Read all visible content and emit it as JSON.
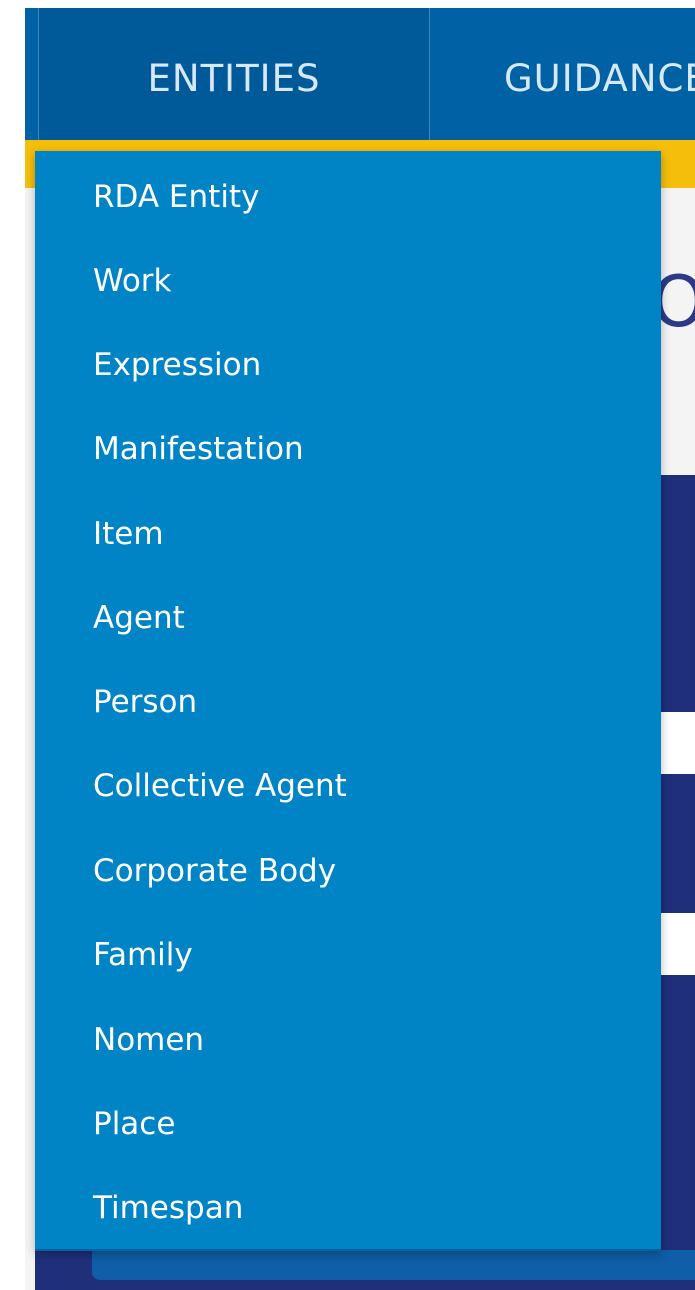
{
  "nav": {
    "tabs": [
      {
        "label": "ENTITIES"
      },
      {
        "label": "GUIDANCE"
      }
    ]
  },
  "page_heading_fragment": "O",
  "dropdown": {
    "items": [
      {
        "label": "RDA Entity"
      },
      {
        "label": "Work"
      },
      {
        "label": "Expression"
      },
      {
        "label": "Manifestation"
      },
      {
        "label": "Item"
      },
      {
        "label": "Agent"
      },
      {
        "label": "Person"
      },
      {
        "label": "Collective Agent"
      },
      {
        "label": "Corporate Body"
      },
      {
        "label": "Family"
      },
      {
        "label": "Nomen"
      },
      {
        "label": "Place"
      },
      {
        "label": "Timespan"
      }
    ]
  },
  "colors": {
    "nav_background": "#0061a4",
    "nav_active_tab": "#005a99",
    "accent_yellow": "#f5be0a",
    "dropdown_background": "#0084c6",
    "dropdown_text": "#ffffff",
    "page_dark_block": "#1f2f7a"
  }
}
